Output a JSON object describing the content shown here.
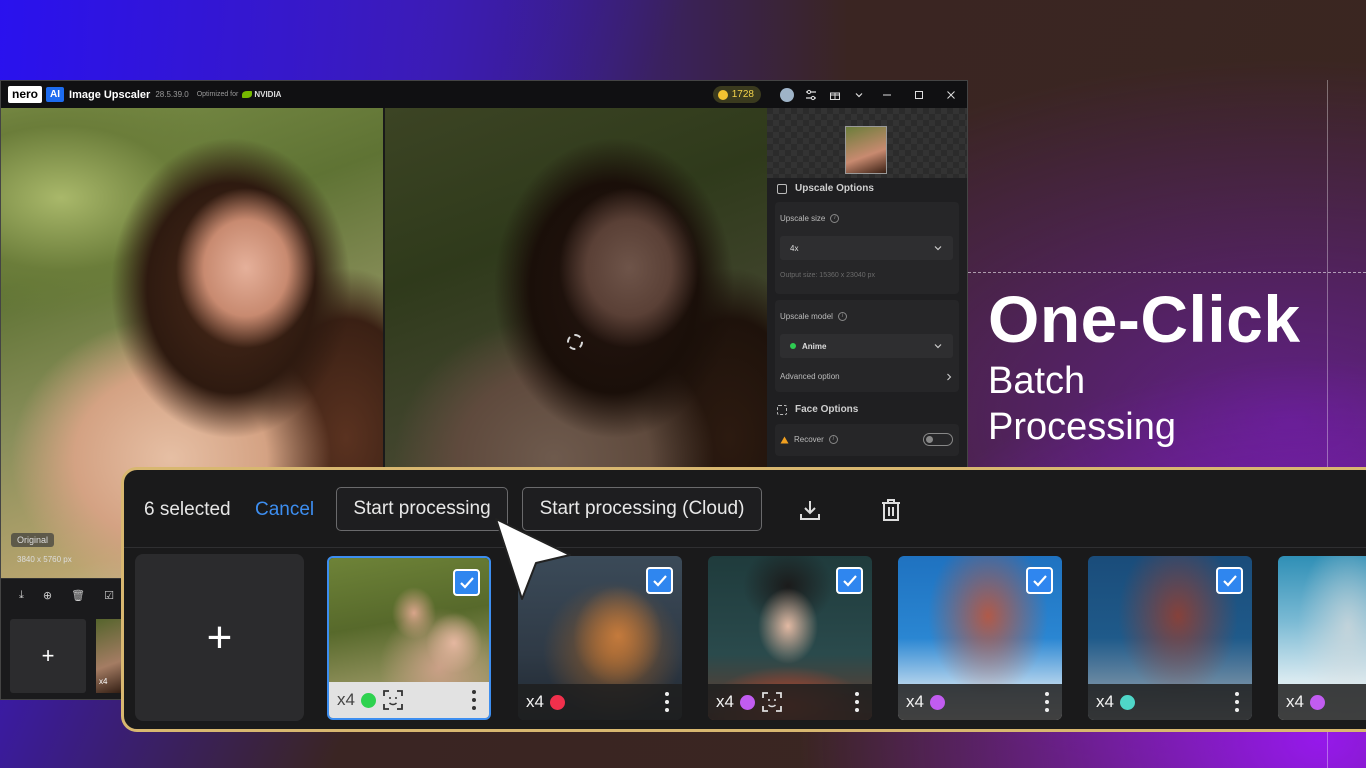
{
  "app": {
    "brand": "nero",
    "ai_badge": "AI",
    "title": "Image Upscaler",
    "version": "28.5.39.0",
    "optimized_for": "Optimized for",
    "gpu_brand": "NVIDIA",
    "credits": "1728"
  },
  "canvas": {
    "original_badge": "Original",
    "original_size": "3840 x 5760 px"
  },
  "panel": {
    "upscale_options": "Upscale Options",
    "upscale_size_label": "Upscale size",
    "upscale_size_value": "4x",
    "output_size": "Output size: 15360 x 23040 px",
    "upscale_model_label": "Upscale model",
    "upscale_model_value": "Anime",
    "advanced_option": "Advanced option",
    "face_options": "Face Options",
    "recover_label": "Recover"
  },
  "app_strip": {
    "add": "+",
    "thumb_tag": "x4"
  },
  "batch": {
    "selected": "6 selected",
    "cancel": "Cancel",
    "start_processing": "Start processing",
    "start_processing_cloud": "Start processing (Cloud)",
    "add": "+",
    "tiles": [
      {
        "scale": "x4",
        "model_color": "#2ed24f",
        "face": true,
        "subject": "two women in garden"
      },
      {
        "scale": "x4",
        "model_color": "#f0304c",
        "face": false,
        "subject": "orange cat"
      },
      {
        "scale": "x4",
        "model_color": "#c15cf0",
        "face": true,
        "subject": "smiling woman"
      },
      {
        "scale": "x4",
        "model_color": "#c15cf0",
        "face": false,
        "subject": "ferris wheel"
      },
      {
        "scale": "x4",
        "model_color": "#4fd6c8",
        "face": false,
        "subject": "ferris wheel dark"
      },
      {
        "scale": "x4",
        "model_color": "#c15cf0",
        "face": false,
        "subject": "ferris wheel side"
      }
    ]
  },
  "headline": {
    "title": "One-Click",
    "line1": "Batch",
    "line2": "Processing"
  },
  "colors": {
    "accent_blue": "#3d8ef0",
    "panel_border": "#d8b770",
    "credits_gold": "#f4d44b"
  }
}
